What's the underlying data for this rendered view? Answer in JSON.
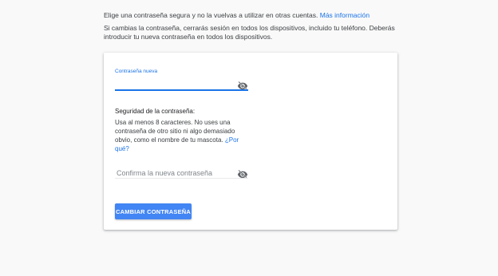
{
  "intro": {
    "line1_text": "Elige una contraseña segura y no la vuelvas a utilizar en otras cuentas. ",
    "line1_link": "Más información",
    "line2_text": "Si cambias la contraseña, cerrarás sesión en todos los dispositivos, incluido tu teléfono. Deberás introducir tu nueva contraseña en todos los dispositivos."
  },
  "form": {
    "new_password": {
      "label": "Contraseña nueva",
      "value": "",
      "icon": "eye-off-icon"
    },
    "strength": {
      "title": "Seguridad de la contraseña:",
      "text": "Usa al menos 8 caracteres. No uses una contraseña de otro sitio ni algo demasiado obvio, como el nombre de tu mascota. ",
      "link": "¿Por qué?"
    },
    "confirm_password": {
      "placeholder": "Confirma la nueva contraseña",
      "value": "",
      "icon": "eye-off-icon"
    },
    "submit_label": "CAMBIAR CONTRASEÑA"
  },
  "colors": {
    "accent": "#1a73e8",
    "button": "#4285f4",
    "background": "#f9f9f9"
  }
}
